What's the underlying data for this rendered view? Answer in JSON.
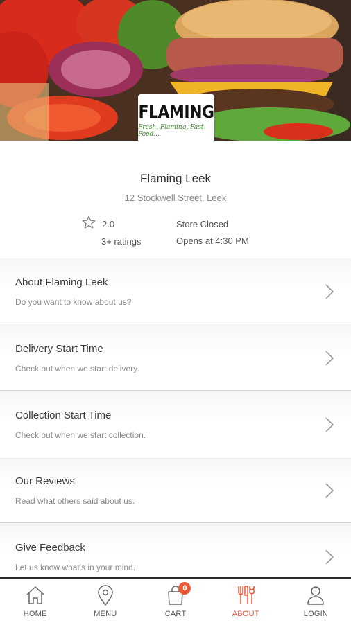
{
  "hero": {
    "image": "burger-banner-image"
  },
  "logo": {
    "word": "FLAMING",
    "tagline": "Fresh, Flaming, Fast Food..."
  },
  "store": {
    "name": "Flaming Leek",
    "address": "12 Stockwell Street, Leek",
    "rating": "2.0",
    "ratings_count": "3+ ratings",
    "status": "Store Closed",
    "opens": "Opens at 4:30 PM"
  },
  "menu": [
    {
      "title": "About Flaming Leek",
      "subtitle": "Do you want to know about us?"
    },
    {
      "title": "Delivery Start Time",
      "subtitle": "Check out when we start delivery."
    },
    {
      "title": "Collection Start Time",
      "subtitle": "Check out when we start collection."
    },
    {
      "title": "Our Reviews",
      "subtitle": "Read what others said about us."
    },
    {
      "title": "Give Feedback",
      "subtitle": "Let us know what's in your mind."
    }
  ],
  "nav": {
    "home": "HOME",
    "menu": "MENU",
    "cart": "CART",
    "cart_count": "0",
    "about": "ABOUT",
    "login": "LOGIN"
  },
  "colors": {
    "accent": "#e8593a",
    "text": "#3c3c3c",
    "muted": "#8a8a8a"
  }
}
